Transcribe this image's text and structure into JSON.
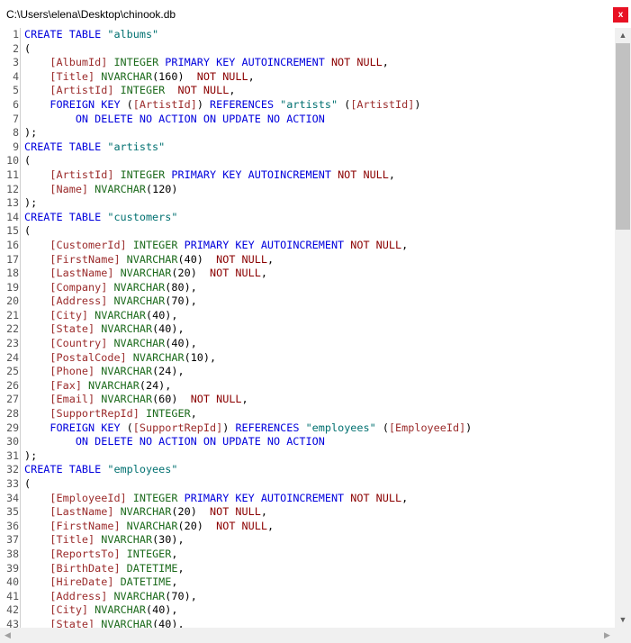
{
  "window": {
    "title": "C:\\Users\\elena\\Desktop\\chinook.db",
    "close_label": "x"
  },
  "scrollbar": {
    "up": "▲",
    "down": "▼",
    "left": "◀",
    "right": "▶"
  },
  "colors": {
    "keyword": "#0000dd",
    "string": "#007070",
    "identifier": "#9b2b2b",
    "type": "#1d6b1d",
    "null": "#8b0000",
    "close_button": "#e81123"
  },
  "code_lines": [
    {
      "n": "1",
      "tokens": [
        [
          "kw",
          "CREATE TABLE"
        ],
        [
          "pl",
          " "
        ],
        [
          "str",
          "\"albums\""
        ]
      ]
    },
    {
      "n": "2",
      "tokens": [
        [
          "pl",
          "("
        ]
      ]
    },
    {
      "n": "3",
      "tokens": [
        [
          "pl",
          "    "
        ],
        [
          "id",
          "[AlbumId]"
        ],
        [
          "pl",
          " "
        ],
        [
          "ty",
          "INTEGER"
        ],
        [
          "pl",
          " "
        ],
        [
          "kw",
          "PRIMARY KEY AUTOINCREMENT"
        ],
        [
          "pl",
          " "
        ],
        [
          "nn",
          "NOT NULL"
        ],
        [
          "pl",
          ","
        ]
      ]
    },
    {
      "n": "4",
      "tokens": [
        [
          "pl",
          "    "
        ],
        [
          "id",
          "[Title]"
        ],
        [
          "pl",
          " "
        ],
        [
          "ty",
          "NVARCHAR"
        ],
        [
          "pl",
          "(160)  "
        ],
        [
          "nn",
          "NOT NULL"
        ],
        [
          "pl",
          ","
        ]
      ]
    },
    {
      "n": "5",
      "tokens": [
        [
          "pl",
          "    "
        ],
        [
          "id",
          "[ArtistId]"
        ],
        [
          "pl",
          " "
        ],
        [
          "ty",
          "INTEGER"
        ],
        [
          "pl",
          "  "
        ],
        [
          "nn",
          "NOT NULL"
        ],
        [
          "pl",
          ","
        ]
      ]
    },
    {
      "n": "6",
      "tokens": [
        [
          "pl",
          "    "
        ],
        [
          "kw",
          "FOREIGN KEY"
        ],
        [
          "pl",
          " ("
        ],
        [
          "id",
          "[ArtistId]"
        ],
        [
          "pl",
          ") "
        ],
        [
          "kw",
          "REFERENCES"
        ],
        [
          "pl",
          " "
        ],
        [
          "str",
          "\"artists\""
        ],
        [
          "pl",
          " ("
        ],
        [
          "id",
          "[ArtistId]"
        ],
        [
          "pl",
          ")"
        ]
      ]
    },
    {
      "n": "7",
      "tokens": [
        [
          "pl",
          "        "
        ],
        [
          "kw",
          "ON DELETE NO ACTION ON UPDATE NO ACTION"
        ]
      ]
    },
    {
      "n": "8",
      "tokens": [
        [
          "pl",
          ");"
        ]
      ]
    },
    {
      "n": "9",
      "tokens": [
        [
          "kw",
          "CREATE TABLE"
        ],
        [
          "pl",
          " "
        ],
        [
          "str",
          "\"artists\""
        ]
      ]
    },
    {
      "n": "10",
      "tokens": [
        [
          "pl",
          "("
        ]
      ]
    },
    {
      "n": "11",
      "tokens": [
        [
          "pl",
          "    "
        ],
        [
          "id",
          "[ArtistId]"
        ],
        [
          "pl",
          " "
        ],
        [
          "ty",
          "INTEGER"
        ],
        [
          "pl",
          " "
        ],
        [
          "kw",
          "PRIMARY KEY AUTOINCREMENT"
        ],
        [
          "pl",
          " "
        ],
        [
          "nn",
          "NOT NULL"
        ],
        [
          "pl",
          ","
        ]
      ]
    },
    {
      "n": "12",
      "tokens": [
        [
          "pl",
          "    "
        ],
        [
          "id",
          "[Name]"
        ],
        [
          "pl",
          " "
        ],
        [
          "ty",
          "NVARCHAR"
        ],
        [
          "pl",
          "(120)"
        ]
      ]
    },
    {
      "n": "13",
      "tokens": [
        [
          "pl",
          ");"
        ]
      ]
    },
    {
      "n": "14",
      "tokens": [
        [
          "kw",
          "CREATE TABLE"
        ],
        [
          "pl",
          " "
        ],
        [
          "str",
          "\"customers\""
        ]
      ]
    },
    {
      "n": "15",
      "tokens": [
        [
          "pl",
          "("
        ]
      ]
    },
    {
      "n": "16",
      "tokens": [
        [
          "pl",
          "    "
        ],
        [
          "id",
          "[CustomerId]"
        ],
        [
          "pl",
          " "
        ],
        [
          "ty",
          "INTEGER"
        ],
        [
          "pl",
          " "
        ],
        [
          "kw",
          "PRIMARY KEY AUTOINCREMENT"
        ],
        [
          "pl",
          " "
        ],
        [
          "nn",
          "NOT NULL"
        ],
        [
          "pl",
          ","
        ]
      ]
    },
    {
      "n": "17",
      "tokens": [
        [
          "pl",
          "    "
        ],
        [
          "id",
          "[FirstName]"
        ],
        [
          "pl",
          " "
        ],
        [
          "ty",
          "NVARCHAR"
        ],
        [
          "pl",
          "(40)  "
        ],
        [
          "nn",
          "NOT NULL"
        ],
        [
          "pl",
          ","
        ]
      ]
    },
    {
      "n": "18",
      "tokens": [
        [
          "pl",
          "    "
        ],
        [
          "id",
          "[LastName]"
        ],
        [
          "pl",
          " "
        ],
        [
          "ty",
          "NVARCHAR"
        ],
        [
          "pl",
          "(20)  "
        ],
        [
          "nn",
          "NOT NULL"
        ],
        [
          "pl",
          ","
        ]
      ]
    },
    {
      "n": "19",
      "tokens": [
        [
          "pl",
          "    "
        ],
        [
          "id",
          "[Company]"
        ],
        [
          "pl",
          " "
        ],
        [
          "ty",
          "NVARCHAR"
        ],
        [
          "pl",
          "(80),"
        ]
      ]
    },
    {
      "n": "20",
      "tokens": [
        [
          "pl",
          "    "
        ],
        [
          "id",
          "[Address]"
        ],
        [
          "pl",
          " "
        ],
        [
          "ty",
          "NVARCHAR"
        ],
        [
          "pl",
          "(70),"
        ]
      ]
    },
    {
      "n": "21",
      "tokens": [
        [
          "pl",
          "    "
        ],
        [
          "id",
          "[City]"
        ],
        [
          "pl",
          " "
        ],
        [
          "ty",
          "NVARCHAR"
        ],
        [
          "pl",
          "(40),"
        ]
      ]
    },
    {
      "n": "22",
      "tokens": [
        [
          "pl",
          "    "
        ],
        [
          "id",
          "[State]"
        ],
        [
          "pl",
          " "
        ],
        [
          "ty",
          "NVARCHAR"
        ],
        [
          "pl",
          "(40),"
        ]
      ]
    },
    {
      "n": "23",
      "tokens": [
        [
          "pl",
          "    "
        ],
        [
          "id",
          "[Country]"
        ],
        [
          "pl",
          " "
        ],
        [
          "ty",
          "NVARCHAR"
        ],
        [
          "pl",
          "(40),"
        ]
      ]
    },
    {
      "n": "24",
      "tokens": [
        [
          "pl",
          "    "
        ],
        [
          "id",
          "[PostalCode]"
        ],
        [
          "pl",
          " "
        ],
        [
          "ty",
          "NVARCHAR"
        ],
        [
          "pl",
          "(10),"
        ]
      ]
    },
    {
      "n": "25",
      "tokens": [
        [
          "pl",
          "    "
        ],
        [
          "id",
          "[Phone]"
        ],
        [
          "pl",
          " "
        ],
        [
          "ty",
          "NVARCHAR"
        ],
        [
          "pl",
          "(24),"
        ]
      ]
    },
    {
      "n": "26",
      "tokens": [
        [
          "pl",
          "    "
        ],
        [
          "id",
          "[Fax]"
        ],
        [
          "pl",
          " "
        ],
        [
          "ty",
          "NVARCHAR"
        ],
        [
          "pl",
          "(24),"
        ]
      ]
    },
    {
      "n": "27",
      "tokens": [
        [
          "pl",
          "    "
        ],
        [
          "id",
          "[Email]"
        ],
        [
          "pl",
          " "
        ],
        [
          "ty",
          "NVARCHAR"
        ],
        [
          "pl",
          "(60)  "
        ],
        [
          "nn",
          "NOT NULL"
        ],
        [
          "pl",
          ","
        ]
      ]
    },
    {
      "n": "28",
      "tokens": [
        [
          "pl",
          "    "
        ],
        [
          "id",
          "[SupportRepId]"
        ],
        [
          "pl",
          " "
        ],
        [
          "ty",
          "INTEGER"
        ],
        [
          "pl",
          ","
        ]
      ]
    },
    {
      "n": "29",
      "tokens": [
        [
          "pl",
          "    "
        ],
        [
          "kw",
          "FOREIGN KEY"
        ],
        [
          "pl",
          " ("
        ],
        [
          "id",
          "[SupportRepId]"
        ],
        [
          "pl",
          ") "
        ],
        [
          "kw",
          "REFERENCES"
        ],
        [
          "pl",
          " "
        ],
        [
          "str",
          "\"employees\""
        ],
        [
          "pl",
          " ("
        ],
        [
          "id",
          "[EmployeeId]"
        ],
        [
          "pl",
          ")"
        ]
      ]
    },
    {
      "n": "30",
      "tokens": [
        [
          "pl",
          "        "
        ],
        [
          "kw",
          "ON DELETE NO ACTION ON UPDATE NO ACTION"
        ]
      ]
    },
    {
      "n": "31",
      "tokens": [
        [
          "pl",
          ");"
        ]
      ]
    },
    {
      "n": "32",
      "tokens": [
        [
          "kw",
          "CREATE TABLE"
        ],
        [
          "pl",
          " "
        ],
        [
          "str",
          "\"employees\""
        ]
      ]
    },
    {
      "n": "33",
      "tokens": [
        [
          "pl",
          "("
        ]
      ]
    },
    {
      "n": "34",
      "tokens": [
        [
          "pl",
          "    "
        ],
        [
          "id",
          "[EmployeeId]"
        ],
        [
          "pl",
          " "
        ],
        [
          "ty",
          "INTEGER"
        ],
        [
          "pl",
          " "
        ],
        [
          "kw",
          "PRIMARY KEY AUTOINCREMENT"
        ],
        [
          "pl",
          " "
        ],
        [
          "nn",
          "NOT NULL"
        ],
        [
          "pl",
          ","
        ]
      ]
    },
    {
      "n": "35",
      "tokens": [
        [
          "pl",
          "    "
        ],
        [
          "id",
          "[LastName]"
        ],
        [
          "pl",
          " "
        ],
        [
          "ty",
          "NVARCHAR"
        ],
        [
          "pl",
          "(20)  "
        ],
        [
          "nn",
          "NOT NULL"
        ],
        [
          "pl",
          ","
        ]
      ]
    },
    {
      "n": "36",
      "tokens": [
        [
          "pl",
          "    "
        ],
        [
          "id",
          "[FirstName]"
        ],
        [
          "pl",
          " "
        ],
        [
          "ty",
          "NVARCHAR"
        ],
        [
          "pl",
          "(20)  "
        ],
        [
          "nn",
          "NOT NULL"
        ],
        [
          "pl",
          ","
        ]
      ]
    },
    {
      "n": "37",
      "tokens": [
        [
          "pl",
          "    "
        ],
        [
          "id",
          "[Title]"
        ],
        [
          "pl",
          " "
        ],
        [
          "ty",
          "NVARCHAR"
        ],
        [
          "pl",
          "(30),"
        ]
      ]
    },
    {
      "n": "38",
      "tokens": [
        [
          "pl",
          "    "
        ],
        [
          "id",
          "[ReportsTo]"
        ],
        [
          "pl",
          " "
        ],
        [
          "ty",
          "INTEGER"
        ],
        [
          "pl",
          ","
        ]
      ]
    },
    {
      "n": "39",
      "tokens": [
        [
          "pl",
          "    "
        ],
        [
          "id",
          "[BirthDate]"
        ],
        [
          "pl",
          " "
        ],
        [
          "ty",
          "DATETIME"
        ],
        [
          "pl",
          ","
        ]
      ]
    },
    {
      "n": "40",
      "tokens": [
        [
          "pl",
          "    "
        ],
        [
          "id",
          "[HireDate]"
        ],
        [
          "pl",
          " "
        ],
        [
          "ty",
          "DATETIME"
        ],
        [
          "pl",
          ","
        ]
      ]
    },
    {
      "n": "41",
      "tokens": [
        [
          "pl",
          "    "
        ],
        [
          "id",
          "[Address]"
        ],
        [
          "pl",
          " "
        ],
        [
          "ty",
          "NVARCHAR"
        ],
        [
          "pl",
          "(70),"
        ]
      ]
    },
    {
      "n": "42",
      "tokens": [
        [
          "pl",
          "    "
        ],
        [
          "id",
          "[City]"
        ],
        [
          "pl",
          " "
        ],
        [
          "ty",
          "NVARCHAR"
        ],
        [
          "pl",
          "(40),"
        ]
      ]
    },
    {
      "n": "43",
      "tokens": [
        [
          "pl",
          "    "
        ],
        [
          "id",
          "[State]"
        ],
        [
          "pl",
          " "
        ],
        [
          "ty",
          "NVARCHAR"
        ],
        [
          "pl",
          "(40),"
        ]
      ]
    }
  ]
}
